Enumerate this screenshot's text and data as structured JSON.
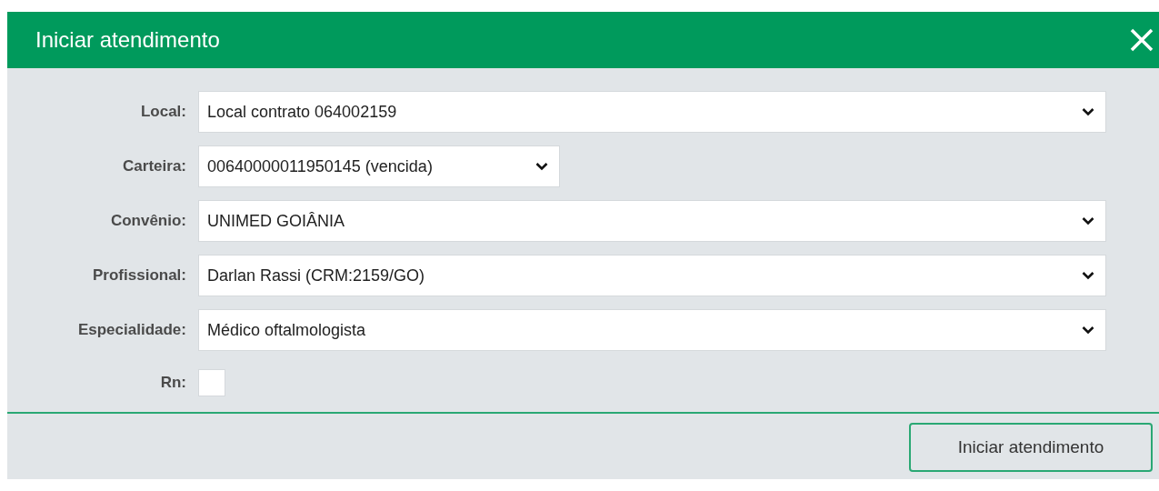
{
  "window": {
    "title": "Iniciar atendimento"
  },
  "fields": [
    {
      "label": "Local:",
      "kind": "select",
      "value": "Local contrato 064002159"
    },
    {
      "label": "Carteira:",
      "kind": "select-short",
      "value": "00640000011950145 (vencida)"
    },
    {
      "label": "Convênio:",
      "kind": "select",
      "value": "UNIMED GOIÂNIA"
    },
    {
      "label": "Profissional:",
      "kind": "select",
      "value": "Darlan Rassi (CRM:2159/GO)"
    },
    {
      "label": "Especialidade:",
      "kind": "select",
      "value": "Médico oftalmologista"
    },
    {
      "label": "Rn:",
      "kind": "checkbox",
      "checked": false
    }
  ],
  "buttons": [
    "Iniciar atendimento"
  ]
}
